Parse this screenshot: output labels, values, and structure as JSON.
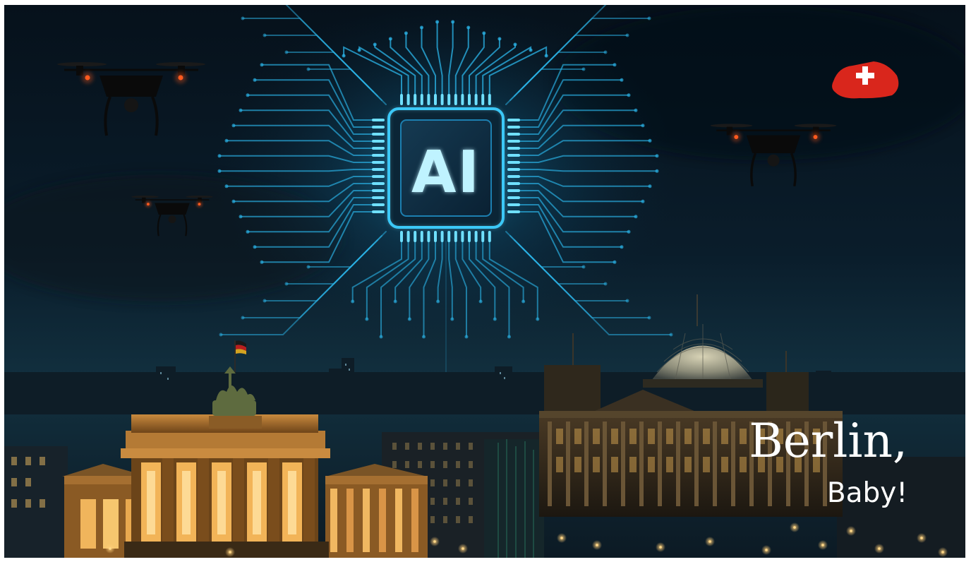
{
  "chip": {
    "label": "AI"
  },
  "caption": {
    "line1": "Berlin,",
    "line2": "Baby!"
  },
  "palette": {
    "sky_top": "#06121d",
    "sky_bottom": "#0f2b3c",
    "circuit_glow": "#27b6ea",
    "chip_text": "#bff3ff",
    "landmark_light": "#e6a24a",
    "drone_light": "#ff5a1f",
    "flag_red": "#d9261c"
  },
  "icons": {
    "chip": "ai-chip-icon",
    "drone": "drone-icon",
    "flag": "swiss-flag-icon",
    "gate": "brandenburg-gate",
    "parliament": "reichstag-building"
  }
}
